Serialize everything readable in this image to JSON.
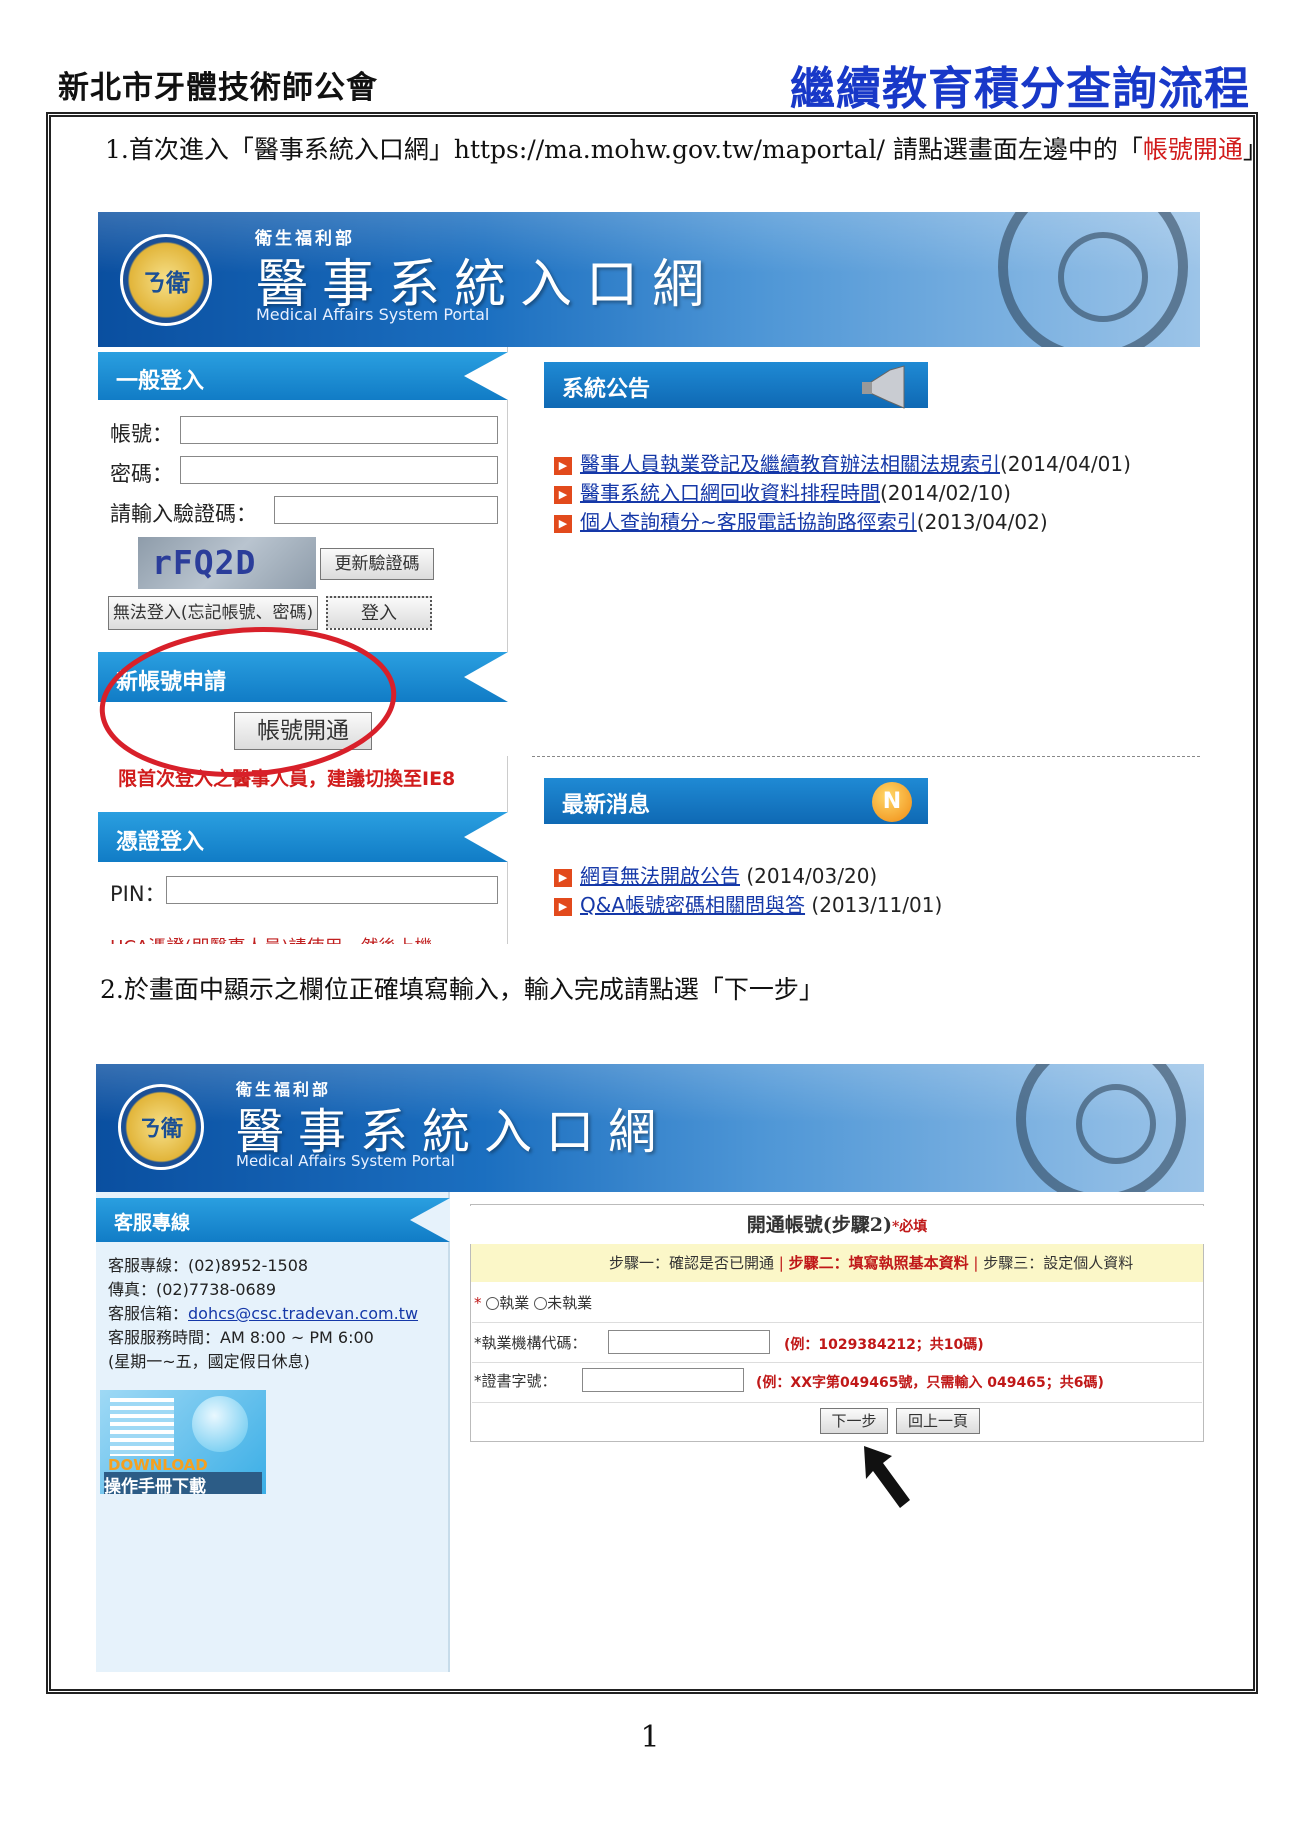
{
  "header": {
    "org": "新北市牙體技術師公會",
    "doc_title": "繼續教育積分查詢流程"
  },
  "step1": {
    "text_prefix": "1.首次進入「醫事系統入口網」https://ma.mohw.gov.tw/maportal/ 請點選畫面左邊中的「",
    "highlight": "帳號開通",
    "text_suffix": "」"
  },
  "step2": {
    "text": "2.於畫面中顯示之欄位正確填寫輸入，輸入完成請點選「下一步」"
  },
  "banner": {
    "ministry": "衛生福利部",
    "title": "醫事系統入口網",
    "subtitle": "Medical Affairs System Portal",
    "logo_text": "ㄋ衛"
  },
  "shot1": {
    "login": {
      "header": "一般登入",
      "account_label": "帳號：",
      "password_label": "密碼：",
      "captcha_label": "請輸入驗證碼：",
      "captcha_value": "rFQ2D",
      "refresh_button": "更新驗證碼",
      "forgot_button": "無法登入(忘記帳號、密碼)",
      "login_button": "登入"
    },
    "new_account": {
      "header": "新帳號申請",
      "open_button": "帳號開通",
      "note": "限首次登入之醫事人員，建議切換至IE8"
    },
    "cert_login": {
      "header": "憑證登入",
      "pin_label": "PIN：",
      "cut_text": "HCA憑證(即醫事人員)請使用，然後上機"
    },
    "announcements": {
      "header": "系統公告",
      "items": [
        {
          "link": "醫事人員執業登記及繼續教育辦法相關法規索引",
          "date": "(2014/04/01)"
        },
        {
          "link": "醫事系統入口網回收資料排程時間",
          "date": "(2014/02/10)"
        },
        {
          "link": "個人查詢積分~客服電話協詢路徑索引",
          "date": "(2013/04/02)"
        }
      ]
    },
    "news": {
      "header": "最新消息",
      "badge": "N",
      "items": [
        {
          "link": "網頁無法開啟公告",
          "date": "(2014/03/20)"
        },
        {
          "link": "Q&A帳號密碼相關問與答",
          "date": "(2013/11/01)"
        }
      ]
    }
  },
  "shot2": {
    "service": {
      "header": "客服專線",
      "phone": "客服專線：(02)8952-1508",
      "fax": "傳真：(02)7738-0689",
      "email_label": "客服信箱：",
      "email": "dohcs@csc.tradevan.com.tw",
      "hours": "客服服務時間：AM 8:00 ~ PM 6:00",
      "hours_note": "(星期一~五，國定假日休息)",
      "download_en": "DOWNLOAD",
      "download_zh": "操作手冊下載"
    },
    "form": {
      "title": "開通帳號(步驟2)",
      "required": "*必填",
      "step_1": "步驟一：確認是否已開通",
      "step_2": "步驟二：填寫執照基本資料",
      "step_3": "步驟三：設定個人資料",
      "star": "*",
      "radio_practicing": "執業",
      "radio_not_practicing": "未執業",
      "org_code_label": "*執業機構代碼：",
      "org_code_hint": "(例：1029384212；共10碼)",
      "cert_label": "*證書字號：",
      "cert_hint": "(例：XX字第049465號，只需輸入 049465；共6碼)",
      "next_button": "下一步",
      "back_button": "回上一頁"
    }
  },
  "page_number": "1"
}
